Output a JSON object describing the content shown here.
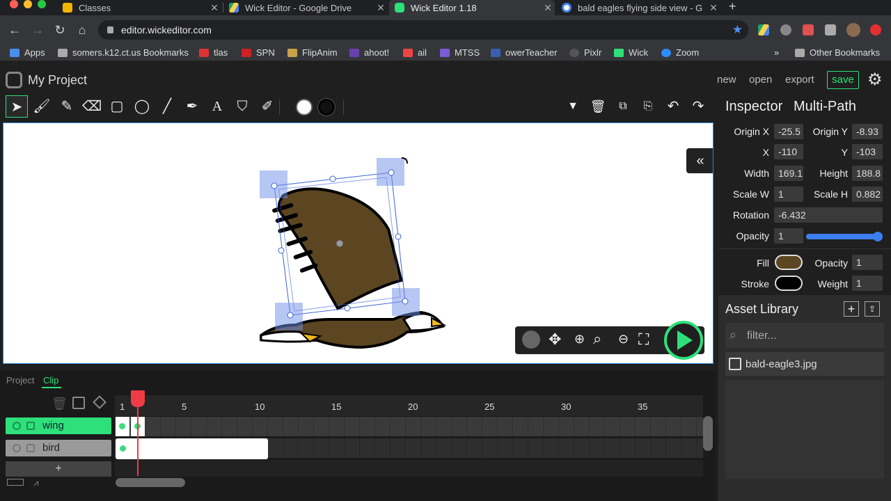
{
  "browser": {
    "tabs": [
      {
        "title": "Classes",
        "fav_color": "#f4b400"
      },
      {
        "title": "Wick Editor - Google Drive",
        "fav_color": "#1fa463"
      },
      {
        "title": "Wick Editor 1.18",
        "fav_color": "#2ee07a"
      },
      {
        "title": "bald eagles flying side view - G",
        "fav_color": "#4285f4"
      }
    ],
    "new_tab": "+",
    "url": "editor.wickeditor.com",
    "bookmarks": [
      "Apps",
      "somers.k12.ct.us Bookmarks",
      "tlas",
      "SPN",
      "FlipAnim",
      "ahoot!",
      "ail",
      "MTSS",
      "owerTeacher",
      "Pixlr",
      "Wick",
      "Zoom"
    ],
    "bookmarks_more": "»",
    "other_bookmarks": "Other Bookmarks"
  },
  "app": {
    "project_name": "My Project",
    "menu": {
      "new": "new",
      "open": "open",
      "export": "export",
      "save": "save"
    },
    "accent": "#2ee07a"
  },
  "inspector": {
    "title": "Inspector",
    "subtitle": "Multi-Path",
    "origin_x_label": "Origin X",
    "origin_x": "-25.5",
    "origin_y_label": "Origin Y",
    "origin_y": "-8.93",
    "x_label": "X",
    "x": "-110",
    "y_label": "Y",
    "y": "-103",
    "width_label": "Width",
    "width": "169.1",
    "height_label": "Height",
    "height": "188.8",
    "scale_w_label": "Scale W",
    "scale_w": "1",
    "scale_h_label": "Scale H",
    "scale_h": "0.882",
    "rotation_label": "Rotation",
    "rotation": "-6.432",
    "opacity_label": "Opacity",
    "opacity": "1",
    "opacity_level": 1.0,
    "fill_label": "Fill",
    "fill_color": "#5c4521",
    "fill_opacity_label": "Opacity",
    "fill_opacity": "1",
    "stroke_label": "Stroke",
    "stroke_color": "#000000",
    "weight_label": "Weight",
    "weight": "1"
  },
  "assets": {
    "title": "Asset Library",
    "filter_placeholder": "filter...",
    "items": [
      "bald-eagle3.jpg"
    ]
  },
  "timeline": {
    "tabs": {
      "project": "Project",
      "clip": "Clip"
    },
    "frame_numbers": [
      "1",
      "5",
      "10",
      "15",
      "20",
      "25",
      "30",
      "35"
    ],
    "layers": [
      {
        "name": "wing",
        "active": true
      },
      {
        "name": "bird",
        "active": false
      }
    ],
    "add_layer": "+",
    "playhead_frame": 2
  }
}
